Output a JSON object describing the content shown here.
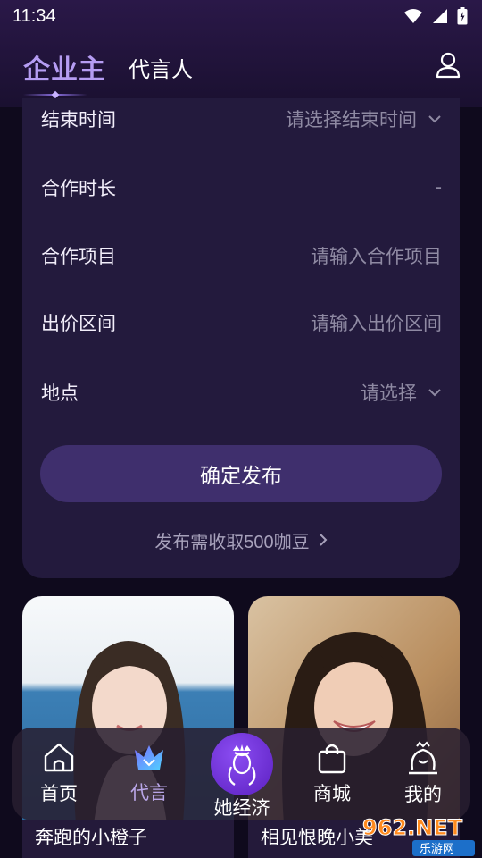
{
  "status_bar": {
    "time": "11:34"
  },
  "header": {
    "logo": "企业主",
    "tab": "代言人"
  },
  "form": {
    "rows": [
      {
        "label": "结束时间",
        "value": "请选择结束时间",
        "chevron": true
      },
      {
        "label": "合作时长",
        "value": "-",
        "chevron": false
      },
      {
        "label": "合作项目",
        "value": "请输入合作项目",
        "chevron": false
      },
      {
        "label": "出价区间",
        "value": "请输入出价区间",
        "chevron": false
      },
      {
        "label": "地点",
        "value": "请选择",
        "chevron": true
      }
    ],
    "submit_label": "确定发布",
    "fee_note": "发布需收取500咖豆"
  },
  "cards": [
    {
      "name": "奔跑的小橙子"
    },
    {
      "name": "相见恨晚小美"
    }
  ],
  "bottom_nav": {
    "items": [
      {
        "label": "首页",
        "icon": "home-icon"
      },
      {
        "label": "代言",
        "icon": "crown-icon",
        "active": true
      },
      {
        "label": "她经济",
        "icon": "queen-icon"
      },
      {
        "label": "商城",
        "icon": "shopping-bag-icon"
      },
      {
        "label": "我的",
        "icon": "profile-icon"
      }
    ]
  },
  "watermark": {
    "text": "962.NET",
    "subtext": "乐游网"
  },
  "colors": {
    "accent": "#3f2f6d",
    "card_bg": "#231a3d",
    "active_nav": "#b9a6e8"
  }
}
